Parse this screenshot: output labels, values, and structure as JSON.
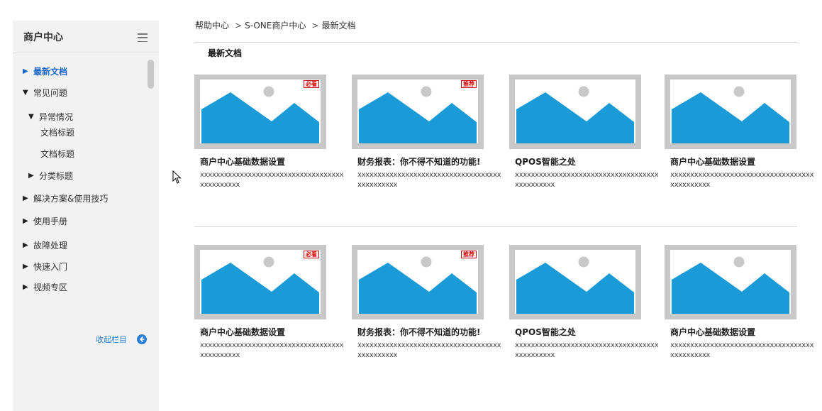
{
  "sidebar": {
    "title": "商户中心",
    "items": [
      {
        "arrow": "▶",
        "label": "最新文档",
        "active": true
      },
      {
        "arrow": "▼",
        "label": "常见问题"
      },
      {
        "arrow": "▼",
        "label": "异常情况"
      },
      {
        "arrow": "",
        "label": "文档标题"
      },
      {
        "arrow": "",
        "label": "文档标题"
      },
      {
        "arrow": "▶",
        "label": "分类标题"
      },
      {
        "arrow": "▶",
        "label": "解决方案&使用技巧"
      },
      {
        "arrow": "▶",
        "label": "使用手册"
      },
      {
        "arrow": "▶",
        "label": "故障处理"
      },
      {
        "arrow": "▶",
        "label": "快速入门"
      },
      {
        "arrow": "▶",
        "label": "视频专区"
      }
    ],
    "collapse_label": "收起栏目"
  },
  "breadcrumb": {
    "items": [
      "帮助中心",
      "S-ONE商户中心",
      "最新文档"
    ],
    "separator": ">"
  },
  "main": {
    "section_title": "最新文档",
    "cards": [
      {
        "title": "商户中心基础数据设置",
        "desc": "xxxxxxxxxxxxxxxxxxxxxxxxxxxxxxxxxxxxxxxxxxxxxx",
        "badge": "必看"
      },
      {
        "title": "财务报表：你不得不知道的功能!",
        "desc": "xxxxxxxxxxxxxxxxxxxxxxxxxxxxxxxxxxxxxxxxxxxxxx",
        "badge": "推荐"
      },
      {
        "title": "QPOS智能之处",
        "desc": "xxxxxxxxxxxxxxxxxxxxxxxxxxxxxxxxxxxxxxxxxxxxxx",
        "badge": ""
      },
      {
        "title": "商户中心基础数据设置",
        "desc": "xxxxxxxxxxxxxxxxxxxxxxxxxxxxxxxxxxxxxxxxxxxxxx",
        "badge": ""
      },
      {
        "title": "商户中心基础数据设置",
        "desc": "xxxxxxxxxxxxxxxxxxxxxxxxxxxxxxxxxxxxxxxxxxxxxx",
        "badge": "必看"
      },
      {
        "title": "财务报表：你不得不知道的功能!",
        "desc": "xxxxxxxxxxxxxxxxxxxxxxxxxxxxxxxxxxxxxxxxxxxxxx",
        "badge": "推荐"
      },
      {
        "title": "QPOS智能之处",
        "desc": "xxxxxxxxxxxxxxxxxxxxxxxxxxxxxxxxxxxxxxxxxxxxxx",
        "badge": ""
      },
      {
        "title": "商户中心基础数据设置",
        "desc": "xxxxxxxxxxxxxxxxxxxxxxxxxxxxxxxxxxxxxxxxxxxxxx",
        "badge": ""
      }
    ]
  },
  "colors": {
    "accent": "#1a66cc",
    "image_placeholder_blue": "#1a9bd7",
    "sidebar_bg": "#f2f2f2",
    "badge_red": "#dd0000"
  },
  "icons": [
    "menu-icon",
    "scrollbar",
    "collapse-arrow-left-icon",
    "mouse-cursor-icon",
    "image-placeholder-icon"
  ]
}
